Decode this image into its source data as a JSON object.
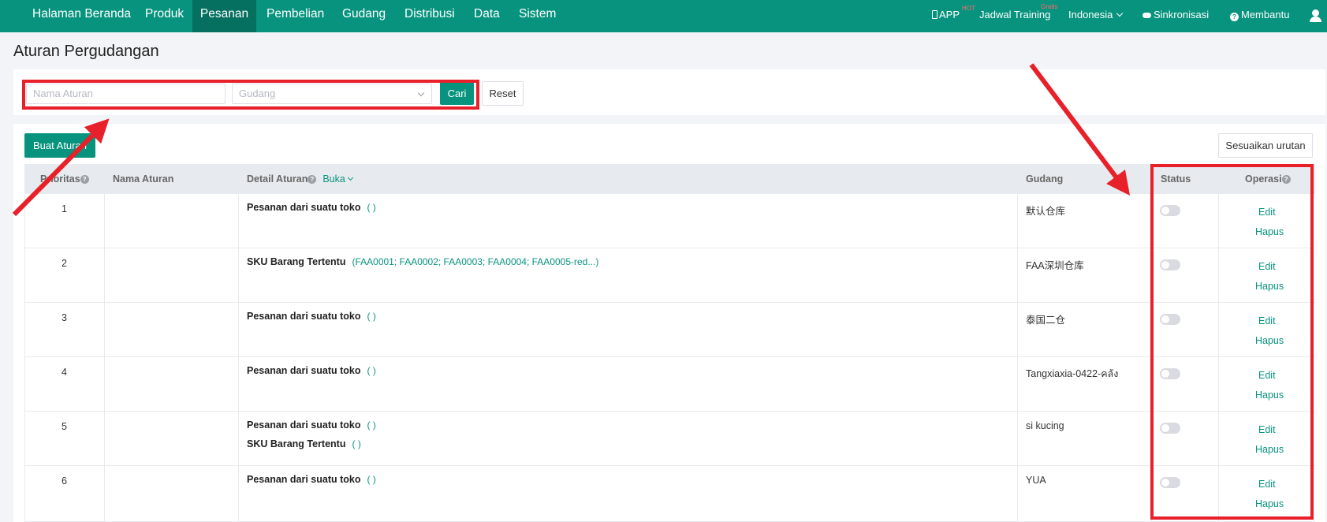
{
  "nav": {
    "items": [
      "Halaman Beranda",
      "Produk",
      "Pesanan",
      "Pembelian",
      "Gudang",
      "Distribusi",
      "Data",
      "Sistem"
    ],
    "active": "Pesanan",
    "app_label": "APP",
    "app_badge": "HOT",
    "training_label": "Jadwal Training",
    "training_badge": "Gratis",
    "language": "Indonesia",
    "sync_label": "Sinkronisasi",
    "help_label": "Membantu"
  },
  "page_title": "Aturan Pergudangan",
  "filters": {
    "rule_name_placeholder": "Nama Aturan",
    "warehouse_placeholder": "Gudang",
    "search_label": "Cari",
    "reset_label": "Reset"
  },
  "toolbar": {
    "create_label": "Buat Aturan",
    "sort_label": "Sesuaikan urutan"
  },
  "table": {
    "headers": {
      "priority": "Prioritas",
      "rule_name": "Nama Aturan",
      "detail": "Detail Aturan",
      "expand": "Buka",
      "warehouse": "Gudang",
      "status": "Status",
      "operation": "Operasi"
    },
    "rows": [
      {
        "priority": "1",
        "name": "",
        "details": [
          {
            "label": "Pesanan dari suatu toko",
            "value": "(                    )"
          }
        ],
        "warehouse": "默认仓库",
        "enabled": false,
        "edit": "Edit",
        "delete": "Hapus"
      },
      {
        "priority": "2",
        "name": "",
        "details": [
          {
            "label": "SKU Barang Tertentu",
            "value": "(FAA0001; FAA0002; FAA0003; FAA0004; FAA0005-red...)"
          }
        ],
        "warehouse": "FAA深圳仓库",
        "enabled": false,
        "edit": "Edit",
        "delete": "Hapus"
      },
      {
        "priority": "3",
        "name": "",
        "details": [
          {
            "label": "Pesanan dari suatu toko",
            "value": "(                                        )"
          }
        ],
        "warehouse": "泰国二仓",
        "enabled": false,
        "edit": "Edit",
        "delete": "Hapus"
      },
      {
        "priority": "4",
        "name": "",
        "details": [
          {
            "label": "Pesanan dari suatu toko",
            "value": "(          )"
          }
        ],
        "warehouse": "Tangxiaxia-0422-คลัง",
        "enabled": false,
        "edit": "Edit",
        "delete": "Hapus"
      },
      {
        "priority": "5",
        "name": "",
        "details": [
          {
            "label": "Pesanan dari suatu toko",
            "value": "(           )"
          },
          {
            "label": "SKU Barang Tertentu",
            "value": "(            )"
          }
        ],
        "warehouse": "si kucing",
        "enabled": false,
        "edit": "Edit",
        "delete": "Hapus"
      },
      {
        "priority": "6",
        "name": "",
        "details": [
          {
            "label": "Pesanan dari suatu toko",
            "value": "(      )"
          }
        ],
        "warehouse": "YUA",
        "enabled": false,
        "edit": "Edit",
        "delete": "Hapus"
      }
    ]
  },
  "annotation_color": "#e8202a",
  "accent_color": "#07937e"
}
